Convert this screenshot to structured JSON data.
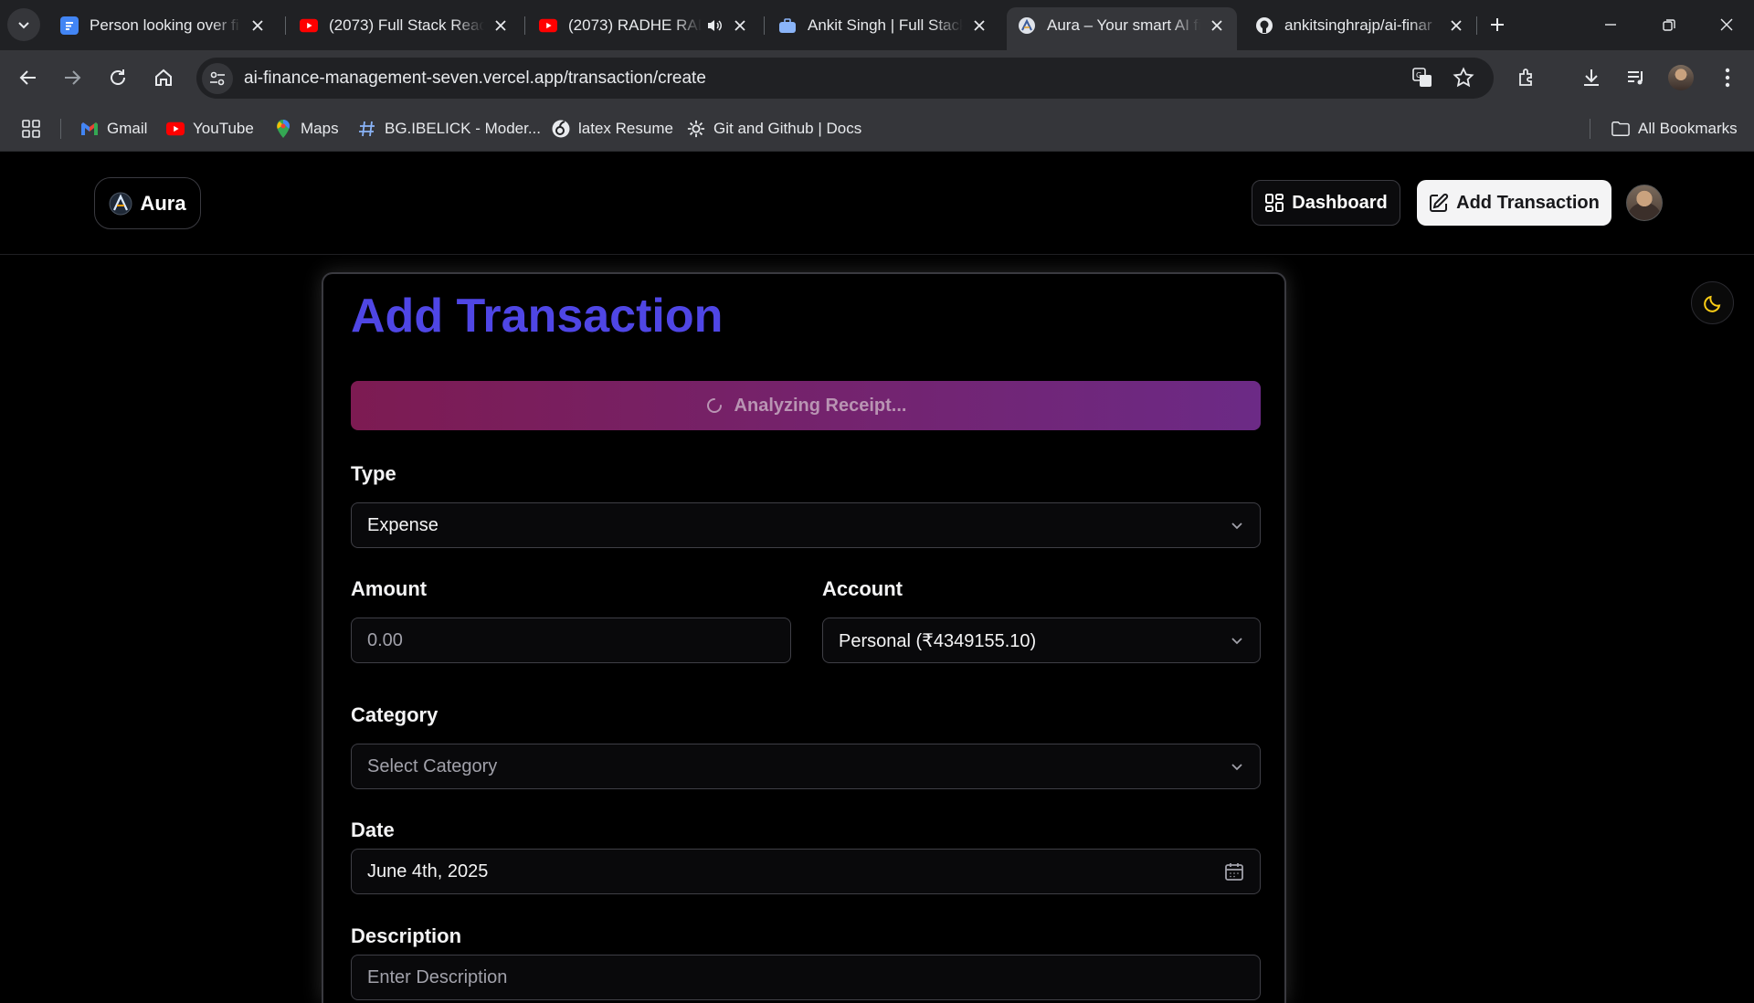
{
  "browser": {
    "tabs": [
      {
        "title": "Person looking over fi",
        "favicon": "doc-icon",
        "color": "#4285f4"
      },
      {
        "title": "(2073) Full Stack React",
        "favicon": "youtube-icon",
        "color": "#ff0000"
      },
      {
        "title": "(2073) RADHE RAD",
        "favicon": "youtube-icon",
        "color": "#ff0000",
        "audio": true
      },
      {
        "title": "Ankit Singh | Full Stack",
        "favicon": "briefcase-icon",
        "color": "#8ab4f8"
      },
      {
        "title": "Aura – Your smart AI fi",
        "favicon": "aura-icon",
        "active": true
      },
      {
        "title": "ankitsinghrajp/ai-finar",
        "favicon": "github-icon"
      }
    ],
    "url": {
      "domain": "ai-finance-management-seven.vercel.app",
      "path": "/transaction/create"
    },
    "bookmarks": [
      {
        "label": "Gmail",
        "icon": "gmail-icon"
      },
      {
        "label": "YouTube",
        "icon": "youtube-icon"
      },
      {
        "label": "Maps",
        "icon": "maps-icon"
      },
      {
        "label": "BG.IBELICK - Moder...",
        "icon": "hash-icon"
      },
      {
        "label": "latex Resume",
        "icon": "overleaf-icon"
      },
      {
        "label": "Git and Github | Docs",
        "icon": "gear-icon"
      }
    ],
    "all_bookmarks": "All Bookmarks"
  },
  "header": {
    "logo_text": "Aura",
    "dashboard_label": "Dashboard",
    "add_transaction_label": "Add Transaction"
  },
  "form": {
    "title": "Add Transaction",
    "scan_status": "Analyzing Receipt...",
    "type": {
      "label": "Type",
      "value": "Expense"
    },
    "amount": {
      "label": "Amount",
      "placeholder": "0.00"
    },
    "account": {
      "label": "Account",
      "value": "Personal (₹4349155.10)"
    },
    "category": {
      "label": "Category",
      "placeholder": "Select Category"
    },
    "date": {
      "label": "Date",
      "value": "June 4th, 2025"
    },
    "description": {
      "label": "Description",
      "placeholder": "Enter Description"
    }
  }
}
